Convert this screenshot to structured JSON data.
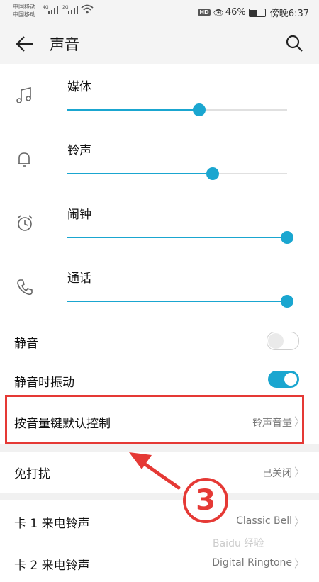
{
  "status_bar": {
    "carrier1": "中国移动",
    "carrier2": "中国移动",
    "net1": "4G",
    "net2": "2G",
    "battery": "46%",
    "time": "傍晚6:37"
  },
  "app_bar": {
    "title": "声音"
  },
  "volumes": [
    {
      "label": "媒体",
      "level": 0.6,
      "icon": "music-note-icon"
    },
    {
      "label": "铃声",
      "level": 0.66,
      "icon": "bell-icon"
    },
    {
      "label": "闹钟",
      "level": 1.0,
      "icon": "alarm-clock-icon"
    },
    {
      "label": "通话",
      "level": 1.0,
      "icon": "phone-icon"
    }
  ],
  "toggles": [
    {
      "label": "静音",
      "state": "off"
    },
    {
      "label": "静音时振动",
      "state": "on"
    }
  ],
  "rows": [
    {
      "label": "按音量键默认控制",
      "value": "铃声音量"
    },
    {
      "label": "免打扰",
      "value": "已关闭"
    },
    {
      "label": "卡 1 来电铃声",
      "value": "Classic Bell"
    },
    {
      "label": "卡 2 来电铃声",
      "value": "Digital Ringtone"
    }
  ],
  "annotation": {
    "step": "3"
  },
  "watermark": "Baidu 经验",
  "colors": {
    "accent": "#1aa6d0",
    "highlight": "#e53935"
  }
}
